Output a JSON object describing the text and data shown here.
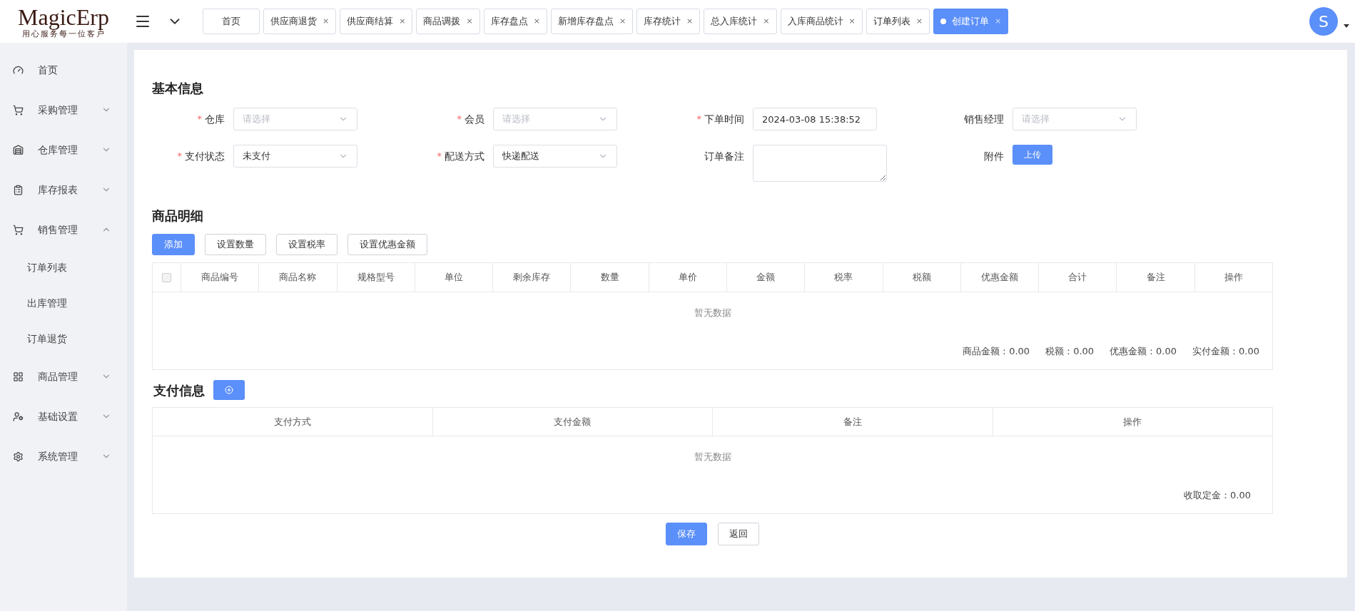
{
  "logo": {
    "name": "MagicErp",
    "slogan": "用心服务每一位客户"
  },
  "header": {
    "avatar": "S"
  },
  "tabs": [
    {
      "label": "首页",
      "selected": false
    },
    {
      "label": "供应商退货",
      "close": "×",
      "selected": false
    },
    {
      "label": "供应商结算",
      "close": "×",
      "selected": false
    },
    {
      "label": "商品调拨",
      "close": "×",
      "selected": false
    },
    {
      "label": "库存盘点",
      "close": "×",
      "selected": false
    },
    {
      "label": "新增库存盘点",
      "close": "×",
      "selected": false
    },
    {
      "label": "库存统计",
      "close": "×",
      "selected": false
    },
    {
      "label": "总入库统计",
      "close": "×",
      "selected": false
    },
    {
      "label": "入库商品统计",
      "close": "×",
      "selected": false
    },
    {
      "label": "订单列表",
      "close": "×",
      "selected": false
    },
    {
      "label": "创建订单",
      "close": "×",
      "selected": true
    }
  ],
  "sidebar": {
    "items": [
      {
        "label": "首页"
      },
      {
        "label": "采购管理",
        "expanded": false
      },
      {
        "label": "仓库管理",
        "expanded": false
      },
      {
        "label": "库存报表",
        "expanded": false
      },
      {
        "label": "销售管理",
        "expanded": true,
        "children": [
          {
            "label": "订单列表"
          },
          {
            "label": "出库管理"
          },
          {
            "label": "订单退货"
          }
        ]
      },
      {
        "label": "商品管理",
        "expanded": false
      },
      {
        "label": "基础设置",
        "expanded": false
      },
      {
        "label": "系统管理",
        "expanded": false
      }
    ]
  },
  "basic_info": {
    "title": "基本信息",
    "fields": [
      {
        "label": "仓库",
        "required_mark": "*",
        "kind": "select",
        "placeholder": "请选择"
      },
      {
        "label": "会员",
        "required_mark": "*",
        "kind": "select",
        "placeholder": "请选择"
      },
      {
        "label": "下单时间",
        "required_mark": "*",
        "kind": "input",
        "value": "2024-03-08 15:38:52"
      },
      {
        "label": "销售经理",
        "kind": "select",
        "placeholder": "请选择"
      },
      {
        "label": "支付状态",
        "required_mark": "*",
        "kind": "select",
        "value": "未支付"
      },
      {
        "label": "配送方式",
        "required_mark": "*",
        "kind": "select",
        "value": "快递配送"
      },
      {
        "label": "订单备注",
        "kind": "textarea"
      },
      {
        "label": "附件",
        "kind": "upload",
        "button": "上传"
      }
    ]
  },
  "goods": {
    "title": "商品明细",
    "buttons": [
      {
        "label": "添加",
        "primary": true
      },
      {
        "label": "设置数量",
        "primary": false
      },
      {
        "label": "设置税率",
        "primary": false
      },
      {
        "label": "设置优惠金额",
        "primary": false
      }
    ],
    "table": {
      "select_all": {
        "checked": false
      },
      "columns": [
        "商品编号",
        "商品名称",
        "规格型号",
        "单位",
        "剩余库存",
        "数量",
        "单价",
        "金额",
        "税率",
        "税额",
        "优惠金额",
        "合计",
        "备注",
        "操作"
      ],
      "empty_text": "暂无数据"
    },
    "summary": [
      "商品金额：0.00",
      "税额：0.00",
      "优惠金额：0.00",
      "实付金额：0.00"
    ]
  },
  "payment": {
    "title": "支付信息",
    "table": {
      "columns": [
        "支付方式",
        "支付金额",
        "备注",
        "操作"
      ],
      "empty_text": "暂无数据"
    },
    "summary": [
      "收取定金：0.00"
    ]
  },
  "actions": [
    {
      "label": "保存",
      "primary": true
    },
    {
      "label": "返回",
      "primary": false
    }
  ]
}
